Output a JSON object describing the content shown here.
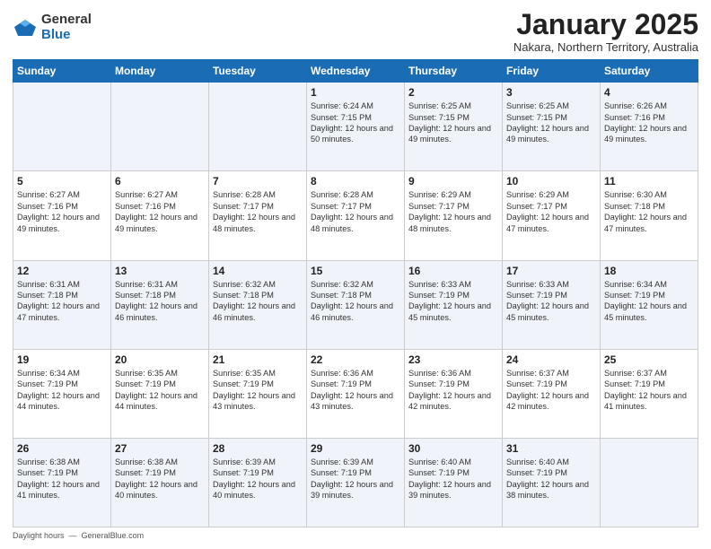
{
  "logo": {
    "general": "General",
    "blue": "Blue"
  },
  "header": {
    "month": "January 2025",
    "location": "Nakara, Northern Territory, Australia"
  },
  "weekdays": [
    "Sunday",
    "Monday",
    "Tuesday",
    "Wednesday",
    "Thursday",
    "Friday",
    "Saturday"
  ],
  "weeks": [
    [
      {
        "day": "",
        "sunrise": "",
        "sunset": "",
        "daylight": ""
      },
      {
        "day": "",
        "sunrise": "",
        "sunset": "",
        "daylight": ""
      },
      {
        "day": "",
        "sunrise": "",
        "sunset": "",
        "daylight": ""
      },
      {
        "day": "1",
        "sunrise": "Sunrise: 6:24 AM",
        "sunset": "Sunset: 7:15 PM",
        "daylight": "Daylight: 12 hours and 50 minutes."
      },
      {
        "day": "2",
        "sunrise": "Sunrise: 6:25 AM",
        "sunset": "Sunset: 7:15 PM",
        "daylight": "Daylight: 12 hours and 49 minutes."
      },
      {
        "day": "3",
        "sunrise": "Sunrise: 6:25 AM",
        "sunset": "Sunset: 7:15 PM",
        "daylight": "Daylight: 12 hours and 49 minutes."
      },
      {
        "day": "4",
        "sunrise": "Sunrise: 6:26 AM",
        "sunset": "Sunset: 7:16 PM",
        "daylight": "Daylight: 12 hours and 49 minutes."
      }
    ],
    [
      {
        "day": "5",
        "sunrise": "Sunrise: 6:27 AM",
        "sunset": "Sunset: 7:16 PM",
        "daylight": "Daylight: 12 hours and 49 minutes."
      },
      {
        "day": "6",
        "sunrise": "Sunrise: 6:27 AM",
        "sunset": "Sunset: 7:16 PM",
        "daylight": "Daylight: 12 hours and 49 minutes."
      },
      {
        "day": "7",
        "sunrise": "Sunrise: 6:28 AM",
        "sunset": "Sunset: 7:17 PM",
        "daylight": "Daylight: 12 hours and 48 minutes."
      },
      {
        "day": "8",
        "sunrise": "Sunrise: 6:28 AM",
        "sunset": "Sunset: 7:17 PM",
        "daylight": "Daylight: 12 hours and 48 minutes."
      },
      {
        "day": "9",
        "sunrise": "Sunrise: 6:29 AM",
        "sunset": "Sunset: 7:17 PM",
        "daylight": "Daylight: 12 hours and 48 minutes."
      },
      {
        "day": "10",
        "sunrise": "Sunrise: 6:29 AM",
        "sunset": "Sunset: 7:17 PM",
        "daylight": "Daylight: 12 hours and 47 minutes."
      },
      {
        "day": "11",
        "sunrise": "Sunrise: 6:30 AM",
        "sunset": "Sunset: 7:18 PM",
        "daylight": "Daylight: 12 hours and 47 minutes."
      }
    ],
    [
      {
        "day": "12",
        "sunrise": "Sunrise: 6:31 AM",
        "sunset": "Sunset: 7:18 PM",
        "daylight": "Daylight: 12 hours and 47 minutes."
      },
      {
        "day": "13",
        "sunrise": "Sunrise: 6:31 AM",
        "sunset": "Sunset: 7:18 PM",
        "daylight": "Daylight: 12 hours and 46 minutes."
      },
      {
        "day": "14",
        "sunrise": "Sunrise: 6:32 AM",
        "sunset": "Sunset: 7:18 PM",
        "daylight": "Daylight: 12 hours and 46 minutes."
      },
      {
        "day": "15",
        "sunrise": "Sunrise: 6:32 AM",
        "sunset": "Sunset: 7:18 PM",
        "daylight": "Daylight: 12 hours and 46 minutes."
      },
      {
        "day": "16",
        "sunrise": "Sunrise: 6:33 AM",
        "sunset": "Sunset: 7:19 PM",
        "daylight": "Daylight: 12 hours and 45 minutes."
      },
      {
        "day": "17",
        "sunrise": "Sunrise: 6:33 AM",
        "sunset": "Sunset: 7:19 PM",
        "daylight": "Daylight: 12 hours and 45 minutes."
      },
      {
        "day": "18",
        "sunrise": "Sunrise: 6:34 AM",
        "sunset": "Sunset: 7:19 PM",
        "daylight": "Daylight: 12 hours and 45 minutes."
      }
    ],
    [
      {
        "day": "19",
        "sunrise": "Sunrise: 6:34 AM",
        "sunset": "Sunset: 7:19 PM",
        "daylight": "Daylight: 12 hours and 44 minutes."
      },
      {
        "day": "20",
        "sunrise": "Sunrise: 6:35 AM",
        "sunset": "Sunset: 7:19 PM",
        "daylight": "Daylight: 12 hours and 44 minutes."
      },
      {
        "day": "21",
        "sunrise": "Sunrise: 6:35 AM",
        "sunset": "Sunset: 7:19 PM",
        "daylight": "Daylight: 12 hours and 43 minutes."
      },
      {
        "day": "22",
        "sunrise": "Sunrise: 6:36 AM",
        "sunset": "Sunset: 7:19 PM",
        "daylight": "Daylight: 12 hours and 43 minutes."
      },
      {
        "day": "23",
        "sunrise": "Sunrise: 6:36 AM",
        "sunset": "Sunset: 7:19 PM",
        "daylight": "Daylight: 12 hours and 42 minutes."
      },
      {
        "day": "24",
        "sunrise": "Sunrise: 6:37 AM",
        "sunset": "Sunset: 7:19 PM",
        "daylight": "Daylight: 12 hours and 42 minutes."
      },
      {
        "day": "25",
        "sunrise": "Sunrise: 6:37 AM",
        "sunset": "Sunset: 7:19 PM",
        "daylight": "Daylight: 12 hours and 41 minutes."
      }
    ],
    [
      {
        "day": "26",
        "sunrise": "Sunrise: 6:38 AM",
        "sunset": "Sunset: 7:19 PM",
        "daylight": "Daylight: 12 hours and 41 minutes."
      },
      {
        "day": "27",
        "sunrise": "Sunrise: 6:38 AM",
        "sunset": "Sunset: 7:19 PM",
        "daylight": "Daylight: 12 hours and 40 minutes."
      },
      {
        "day": "28",
        "sunrise": "Sunrise: 6:39 AM",
        "sunset": "Sunset: 7:19 PM",
        "daylight": "Daylight: 12 hours and 40 minutes."
      },
      {
        "day": "29",
        "sunrise": "Sunrise: 6:39 AM",
        "sunset": "Sunset: 7:19 PM",
        "daylight": "Daylight: 12 hours and 39 minutes."
      },
      {
        "day": "30",
        "sunrise": "Sunrise: 6:40 AM",
        "sunset": "Sunset: 7:19 PM",
        "daylight": "Daylight: 12 hours and 39 minutes."
      },
      {
        "day": "31",
        "sunrise": "Sunrise: 6:40 AM",
        "sunset": "Sunset: 7:19 PM",
        "daylight": "Daylight: 12 hours and 38 minutes."
      },
      {
        "day": "",
        "sunrise": "",
        "sunset": "",
        "daylight": ""
      }
    ]
  ],
  "footer": {
    "daylight_label": "Daylight hours",
    "source": "GeneralBlue.com"
  }
}
